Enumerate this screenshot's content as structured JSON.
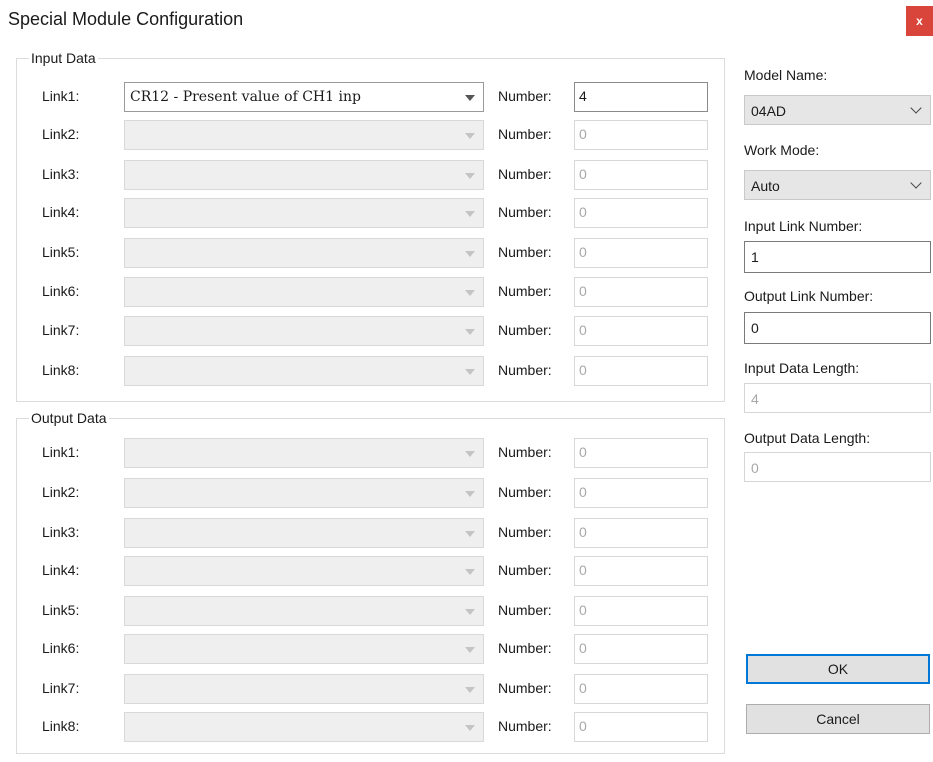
{
  "window": {
    "title": "Special Module Configuration",
    "close_glyph": "x"
  },
  "input_data": {
    "legend": "Input Data",
    "links": [
      {
        "label": "Link1:",
        "value": "CR12 - Present value of CH1 inp",
        "number": "4",
        "enabled": true
      },
      {
        "label": "Link2:",
        "value": "",
        "number": "0",
        "enabled": false
      },
      {
        "label": "Link3:",
        "value": "",
        "number": "0",
        "enabled": false
      },
      {
        "label": "Link4:",
        "value": "",
        "number": "0",
        "enabled": false
      },
      {
        "label": "Link5:",
        "value": "",
        "number": "0",
        "enabled": false
      },
      {
        "label": "Link6:",
        "value": "",
        "number": "0",
        "enabled": false
      },
      {
        "label": "Link7:",
        "value": "",
        "number": "0",
        "enabled": false
      },
      {
        "label": "Link8:",
        "value": "",
        "number": "0",
        "enabled": false
      }
    ]
  },
  "output_data": {
    "legend": "Output Data",
    "links": [
      {
        "label": "Link1:",
        "value": "",
        "number": "0",
        "enabled": false
      },
      {
        "label": "Link2:",
        "value": "",
        "number": "0",
        "enabled": false
      },
      {
        "label": "Link3:",
        "value": "",
        "number": "0",
        "enabled": false
      },
      {
        "label": "Link4:",
        "value": "",
        "number": "0",
        "enabled": false
      },
      {
        "label": "Link5:",
        "value": "",
        "number": "0",
        "enabled": false
      },
      {
        "label": "Link6:",
        "value": "",
        "number": "0",
        "enabled": false
      },
      {
        "label": "Link7:",
        "value": "",
        "number": "0",
        "enabled": false
      },
      {
        "label": "Link8:",
        "value": "",
        "number": "0",
        "enabled": false
      }
    ]
  },
  "number_label": "Number:",
  "right_panel": {
    "model_name_label": "Model Name:",
    "model_name_value": "04AD",
    "work_mode_label": "Work Mode:",
    "work_mode_value": "Auto",
    "input_link_number_label": "Input Link Number:",
    "input_link_number_value": "1",
    "output_link_number_label": "Output Link Number:",
    "output_link_number_value": "0",
    "input_data_length_label": "Input Data Length:",
    "input_data_length_value": "4",
    "output_data_length_label": "Output Data Length:",
    "output_data_length_value": "0"
  },
  "buttons": {
    "ok": "OK",
    "cancel": "Cancel"
  },
  "colors": {
    "close_button": "#d9453b",
    "default_button_border": "#0078d7"
  }
}
